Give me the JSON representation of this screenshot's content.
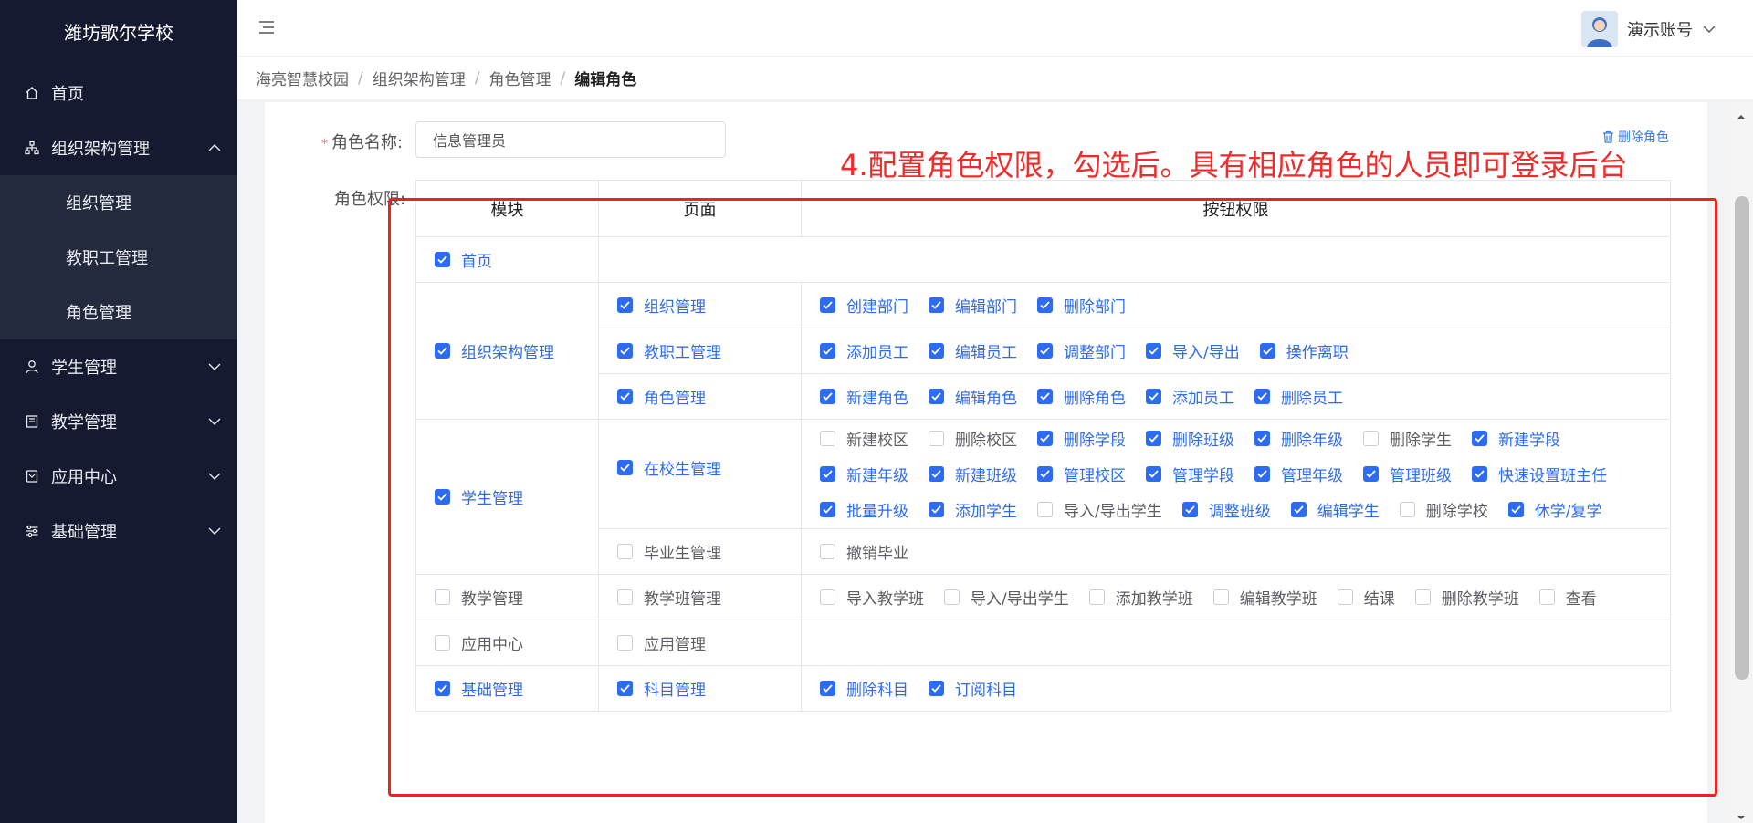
{
  "sidebar": {
    "brand": "潍坊歌尔学校",
    "items": [
      {
        "label": "首页",
        "icon": "home-icon"
      },
      {
        "label": "组织架构管理",
        "icon": "org-chart-icon",
        "expanded": true,
        "children": [
          {
            "label": "组织管理"
          },
          {
            "label": "教职工管理"
          },
          {
            "label": "角色管理"
          }
        ]
      },
      {
        "label": "学生管理",
        "icon": "student-icon"
      },
      {
        "label": "教学管理",
        "icon": "book-icon"
      },
      {
        "label": "应用中心",
        "icon": "app-icon"
      },
      {
        "label": "基础管理",
        "icon": "sliders-icon"
      }
    ]
  },
  "header": {
    "user_name": "演示账号"
  },
  "breadcrumb": [
    "海亮智慧校园",
    "组织架构管理",
    "角色管理",
    "编辑角色"
  ],
  "form": {
    "role_name_label": "角色名称:",
    "role_name_value": "信息管理员",
    "permission_label": "角色权限:",
    "delete_role": "删除角色"
  },
  "annotation": "4.配置角色权限，勾选后。具有相应角色的人员即可登录后台",
  "table": {
    "headers": [
      "模块",
      "页面",
      "按钮权限"
    ],
    "modules": [
      {
        "label": "首页",
        "checked": true,
        "pages": []
      },
      {
        "label": "组织架构管理",
        "checked": true,
        "pages": [
          {
            "label": "组织管理",
            "checked": true,
            "buttons": [
              {
                "label": "创建部门",
                "checked": true
              },
              {
                "label": "编辑部门",
                "checked": true
              },
              {
                "label": "删除部门",
                "checked": true
              }
            ]
          },
          {
            "label": "教职工管理",
            "checked": true,
            "buttons": [
              {
                "label": "添加员工",
                "checked": true
              },
              {
                "label": "编辑员工",
                "checked": true
              },
              {
                "label": "调整部门",
                "checked": true
              },
              {
                "label": "导入/导出",
                "checked": true
              },
              {
                "label": "操作离职",
                "checked": true
              }
            ]
          },
          {
            "label": "角色管理",
            "checked": true,
            "buttons": [
              {
                "label": "新建角色",
                "checked": true
              },
              {
                "label": "编辑角色",
                "checked": true
              },
              {
                "label": "删除角色",
                "checked": true
              },
              {
                "label": "添加员工",
                "checked": true
              },
              {
                "label": "删除员工",
                "checked": true
              }
            ]
          }
        ]
      },
      {
        "label": "学生管理",
        "checked": true,
        "pages": [
          {
            "label": "在校生管理",
            "checked": true,
            "buttons": [
              {
                "label": "新建校区",
                "checked": false
              },
              {
                "label": "删除校区",
                "checked": false
              },
              {
                "label": "删除学段",
                "checked": true
              },
              {
                "label": "删除班级",
                "checked": true
              },
              {
                "label": "删除年级",
                "checked": true
              },
              {
                "label": "删除学生",
                "checked": false
              },
              {
                "label": "新建学段",
                "checked": true
              },
              {
                "label": "新建年级",
                "checked": true
              },
              {
                "label": "新建班级",
                "checked": true
              },
              {
                "label": "管理校区",
                "checked": true
              },
              {
                "label": "管理学段",
                "checked": true
              },
              {
                "label": "管理年级",
                "checked": true
              },
              {
                "label": "管理班级",
                "checked": true
              },
              {
                "label": "快速设置班主任",
                "checked": true
              },
              {
                "label": "批量升级",
                "checked": true
              },
              {
                "label": "添加学生",
                "checked": true
              },
              {
                "label": "导入/导出学生",
                "checked": false
              },
              {
                "label": "调整班级",
                "checked": true
              },
              {
                "label": "编辑学生",
                "checked": true
              },
              {
                "label": "删除学校",
                "checked": false
              },
              {
                "label": "休学/复学",
                "checked": true
              }
            ]
          },
          {
            "label": "毕业生管理",
            "checked": false,
            "buttons": [
              {
                "label": "撤销毕业",
                "checked": false
              }
            ]
          }
        ]
      },
      {
        "label": "教学管理",
        "checked": false,
        "pages": [
          {
            "label": "教学班管理",
            "checked": false,
            "buttons": [
              {
                "label": "导入教学班",
                "checked": false
              },
              {
                "label": "导入/导出学生",
                "checked": false
              },
              {
                "label": "添加教学班",
                "checked": false
              },
              {
                "label": "编辑教学班",
                "checked": false
              },
              {
                "label": "结课",
                "checked": false
              },
              {
                "label": "删除教学班",
                "checked": false
              },
              {
                "label": "查看",
                "checked": false
              }
            ]
          }
        ]
      },
      {
        "label": "应用中心",
        "checked": false,
        "pages": [
          {
            "label": "应用管理",
            "checked": false,
            "buttons": []
          }
        ]
      },
      {
        "label": "基础管理",
        "checked": true,
        "pages": [
          {
            "label": "科目管理",
            "checked": true,
            "buttons": [
              {
                "label": "删除科目",
                "checked": true
              },
              {
                "label": "订阅科目",
                "checked": true
              }
            ]
          }
        ]
      }
    ]
  },
  "colors": {
    "sidebar_bg": "#151a30",
    "submenu_bg": "#242a3d",
    "accent": "#2d6cf2",
    "annotation": "#ef2b2b"
  }
}
